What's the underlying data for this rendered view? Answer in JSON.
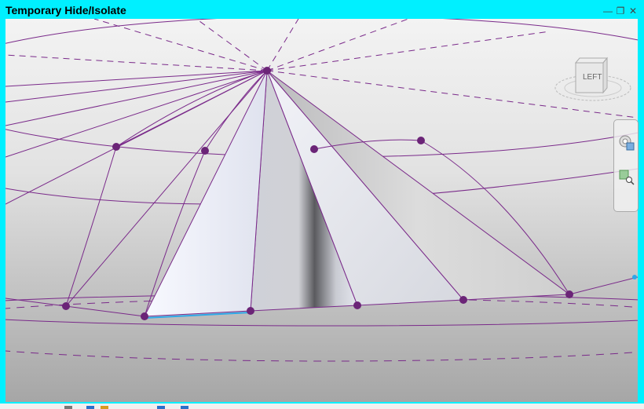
{
  "view": {
    "mode_label": "Temporary Hide/Isolate",
    "viewcube_face": "LEFT",
    "window_controls": [
      "minimize-icon",
      "restore-icon",
      "close-icon"
    ],
    "colors": {
      "highlight": "#00f0ff",
      "reference_lines": "#7a2a8a",
      "grip": "#6b2477",
      "selected_edge": "#2ea8e8"
    }
  }
}
